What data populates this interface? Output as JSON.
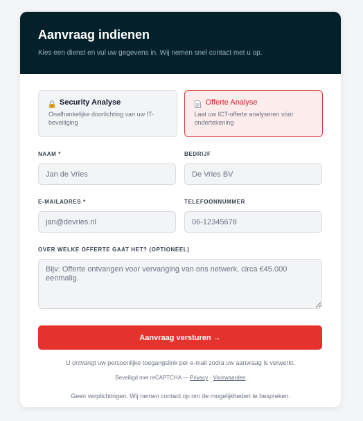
{
  "header": {
    "title": "Aanvraag indienen",
    "subtitle": "Kies een dienst en vul uw gegevens in. Wij nemen snel contact met u op."
  },
  "services": [
    {
      "icon": "lock-icon",
      "title": "Security Analyse",
      "description": "Onafhankelijke doorlichting van uw IT-beveiliging",
      "selected": false
    },
    {
      "icon": "document-icon",
      "title": "Offerte Analyse",
      "description": "Laat uw ICT-offerte analyseren vóór ondertekening",
      "selected": true
    }
  ],
  "form": {
    "name": {
      "label": "NAAM *",
      "placeholder": "Jan de Vries",
      "value": ""
    },
    "company": {
      "label": "BEDRIJF",
      "placeholder": "De Vries BV",
      "value": ""
    },
    "email": {
      "label": "E-MAILADRES *",
      "placeholder": "jan@devries.nl",
      "value": ""
    },
    "phone": {
      "label": "TELEFOONNUMMER",
      "placeholder": "06-12345678",
      "value": ""
    },
    "question": {
      "label": "OVER WELKE OFFERTE GAAT HET? (OPTIONEEL)",
      "placeholder": "Bijv: Offerte ontvangen voor vervanging van ons netwerk, circa €45.000 eenmalig.",
      "value": ""
    },
    "submit_label": "Aanvraag versturen →"
  },
  "notes": {
    "access_link": "U ontvangt uw persoonlijke toegangslink per e-mail zodra uw aanvraag is verwerkt.",
    "captcha_prefix": "Beveiligd met reCAPTCHA — ",
    "privacy_link": "Privacy",
    "separator": " · ",
    "terms_link": "Voorwaarden",
    "no_obligation": "Geen verplichtingen. Wij nemen contact op om de mogelijkheden te bespreken."
  },
  "colors": {
    "header_bg": "#04212b",
    "accent": "#e5322d",
    "selected_border": "#d93a3a",
    "selected_bg": "#fdecec"
  }
}
